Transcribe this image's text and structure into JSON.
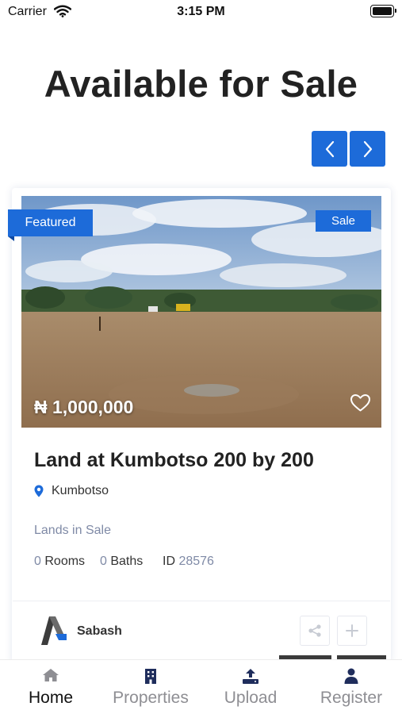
{
  "status_bar": {
    "carrier": "Carrier",
    "time": "3:15 PM"
  },
  "page": {
    "title": "Available for Sale"
  },
  "listing": {
    "featured_badge": "Featured",
    "sale_badge": "Sale",
    "price": "₦ 1,000,000",
    "title": "Land at Kumbotso 200 by 200",
    "location": "Kumbotso",
    "category": "Lands in Sale",
    "rooms_count": "0",
    "rooms_label": "Rooms",
    "baths_count": "0",
    "baths_label": "Baths",
    "id_label": "ID",
    "id_value": "28576",
    "agent_name": "Sabash"
  },
  "tabs": [
    {
      "label": "Home",
      "icon": "home-icon",
      "active": true
    },
    {
      "label": "Properties",
      "icon": "building-icon",
      "active": false
    },
    {
      "label": "Upload",
      "icon": "upload-icon",
      "active": false
    },
    {
      "label": "Register",
      "icon": "user-icon",
      "active": false
    }
  ],
  "colors": {
    "accent": "#1d6bd9",
    "muted_text": "#7f8aa6",
    "tab_inactive": "#8e8e93",
    "tab_icon": "#1f2d5c"
  }
}
